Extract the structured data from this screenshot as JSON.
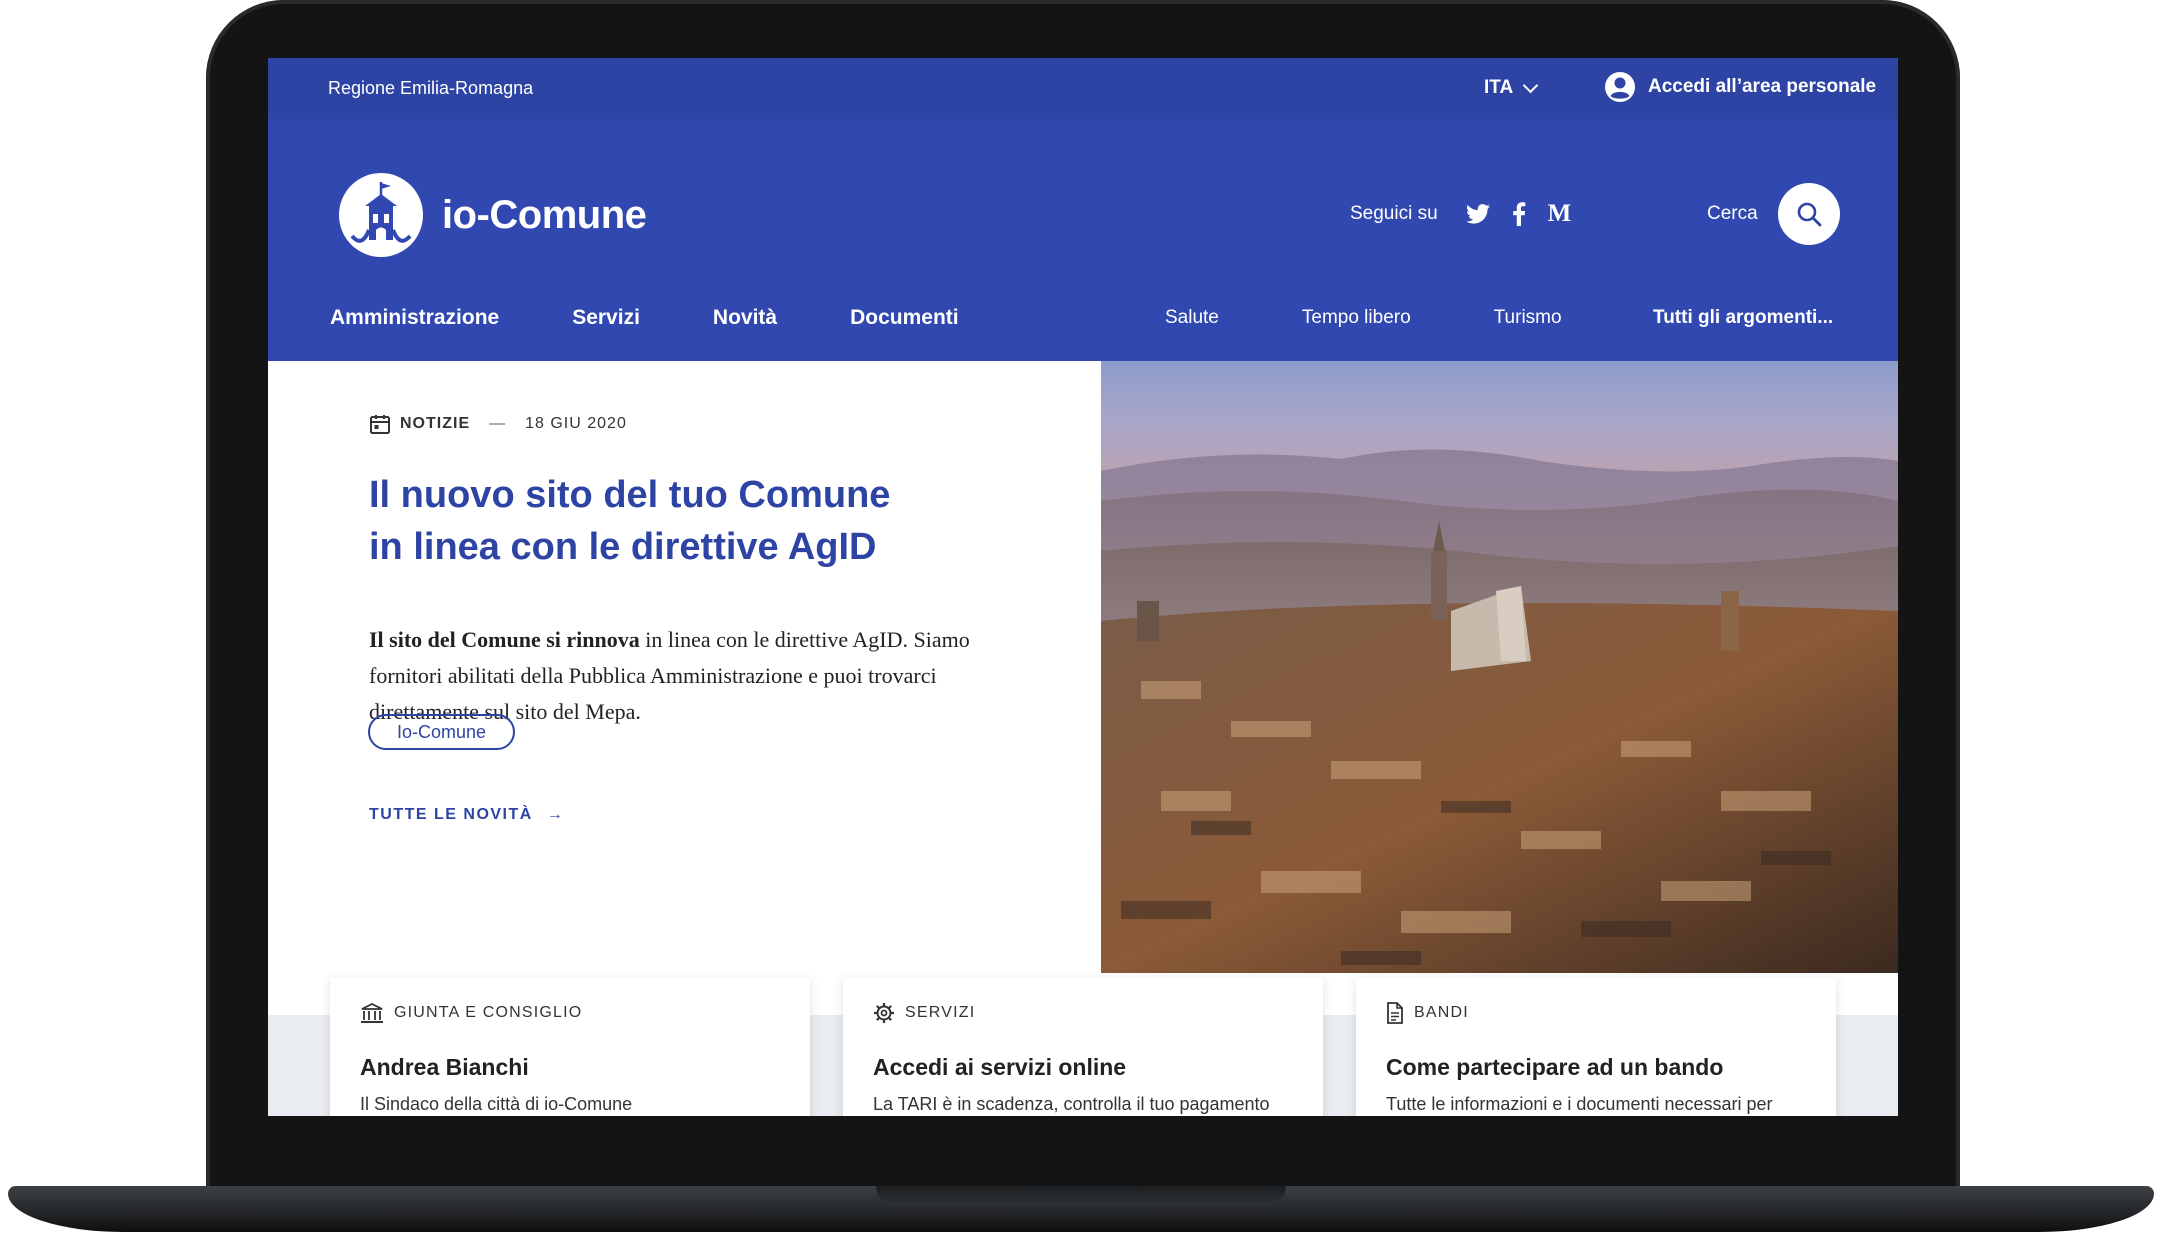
{
  "header_slim": {
    "region": "Regione Emilia-Romagna",
    "language": "ITA",
    "login_label": "Accedi all’area personale"
  },
  "header_center": {
    "brand_name": "io-Comune",
    "social_label": "Seguici su",
    "social_icons": [
      "twitter-icon",
      "facebook-icon",
      "medium-icon"
    ],
    "medium_glyph": "M",
    "search_label": "Cerca"
  },
  "nav": {
    "main": [
      "Amministrazione",
      "Servizi",
      "Novità",
      "Documenti"
    ],
    "topics": [
      "Salute",
      "Tempo libero",
      "Turismo"
    ],
    "all_topics": "Tutti gli argomenti..."
  },
  "hero": {
    "category": "NOTIZIE",
    "date_separator": "—",
    "date": "18 GIU 2020",
    "title_line1": "Il nuovo sito del tuo Comune",
    "title_line2": "in linea con le direttive AgID",
    "lead_bold": "Il sito del Comune si rinnova",
    "lead_rest": " in linea con le direttive AgID. Siamo fornitori abilitati della Pubblica Amministrazione e puoi trovarci direttamente sul sito del Mepa.",
    "tag": "Io-Comune",
    "all_news": "TUTTE LE NOVITÀ",
    "all_news_arrow": "→"
  },
  "cards": [
    {
      "category": "GIUNTA E CONSIGLIO",
      "icon": "building-icon",
      "title": "Andrea Bianchi",
      "description": "Il Sindaco della città di io-Comune"
    },
    {
      "category": "SERVIZI",
      "icon": "gear-icon",
      "title": "Accedi ai servizi online",
      "description": "La TARI è in scadenza, controlla il tuo pagamento"
    },
    {
      "category": "BANDI",
      "icon": "document-icon",
      "title": "Come partecipare ad un bando",
      "description": "Tutte le informazioni e i documenti necessari per"
    }
  ],
  "colors": {
    "primary": "#2d44a4",
    "header": "#3048b0",
    "frame": "#141414",
    "card_background": "#e9ecf0"
  }
}
